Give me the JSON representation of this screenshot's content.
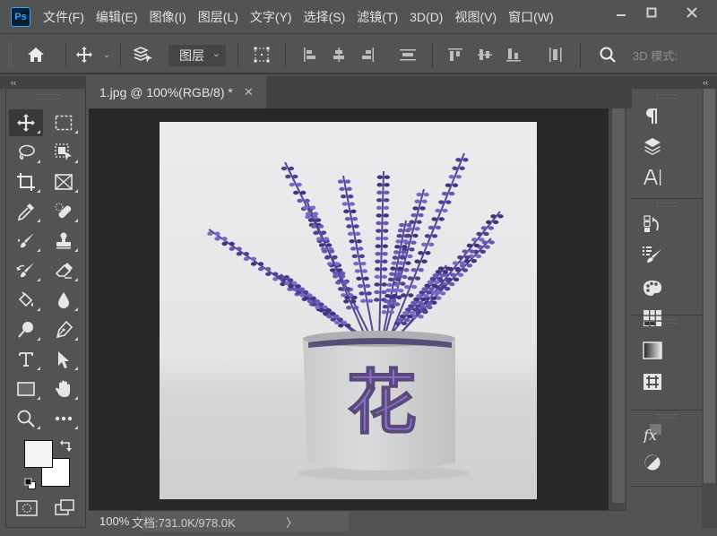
{
  "app": {
    "logo_text": "Ps"
  },
  "menu": {
    "items": [
      {
        "label": "文件(F)"
      },
      {
        "label": "编辑(E)"
      },
      {
        "label": "图像(I)"
      },
      {
        "label": "图层(L)"
      },
      {
        "label": "文字(Y)"
      },
      {
        "label": "选择(S)"
      },
      {
        "label": "滤镜(T)"
      },
      {
        "label": "3D(D)"
      },
      {
        "label": "视图(V)"
      },
      {
        "label": "窗口(W)"
      }
    ]
  },
  "window_controls": {
    "minimize": "—",
    "maximize": "☐",
    "close": "✕"
  },
  "options_bar": {
    "auto_select_value": "图层",
    "mode_3d_label": "3D 模式:"
  },
  "panels": {
    "collapse_left": "‹‹",
    "collapse_right": "‹‹"
  },
  "document_tab": {
    "title": "1.jpg @ 100%(RGB/8) *",
    "close": "✕"
  },
  "canvas": {
    "overlay_text": "花",
    "text_color": "#8f6fd0",
    "flower_color": "#5b4aa3"
  },
  "status_bar": {
    "zoom": "100%",
    "doc_info": "文档:731.0K/978.0K",
    "arrow": "〉"
  },
  "colors": {
    "foreground": "#f4f4f4",
    "background": "#ffffff"
  }
}
